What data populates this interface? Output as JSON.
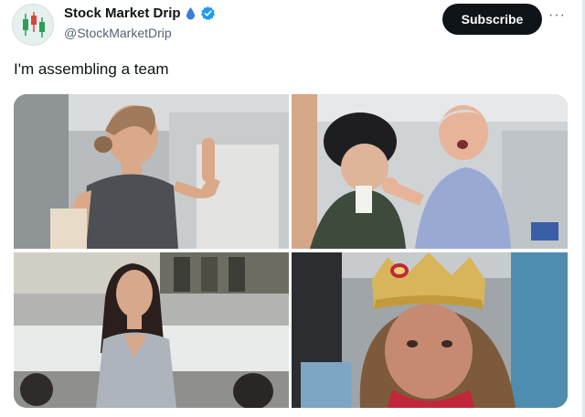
{
  "account": {
    "display_name": "Stock Market Drip",
    "handle": "@StockMarketDrip",
    "avatar_icon": "candlestick-chart-avatar",
    "drop_icon": "water-drop-icon",
    "verified_icon": "verified-badge-icon"
  },
  "actions": {
    "subscribe_label": "Subscribe",
    "more_label": "···"
  },
  "tweet": {
    "text": "I'm assembling a team"
  },
  "media": {
    "layout": "2x2 grid",
    "count": 4
  },
  "colors": {
    "verified": "#1d9bf0",
    "subscribe_bg": "#0f1419",
    "handle": "#536471"
  }
}
